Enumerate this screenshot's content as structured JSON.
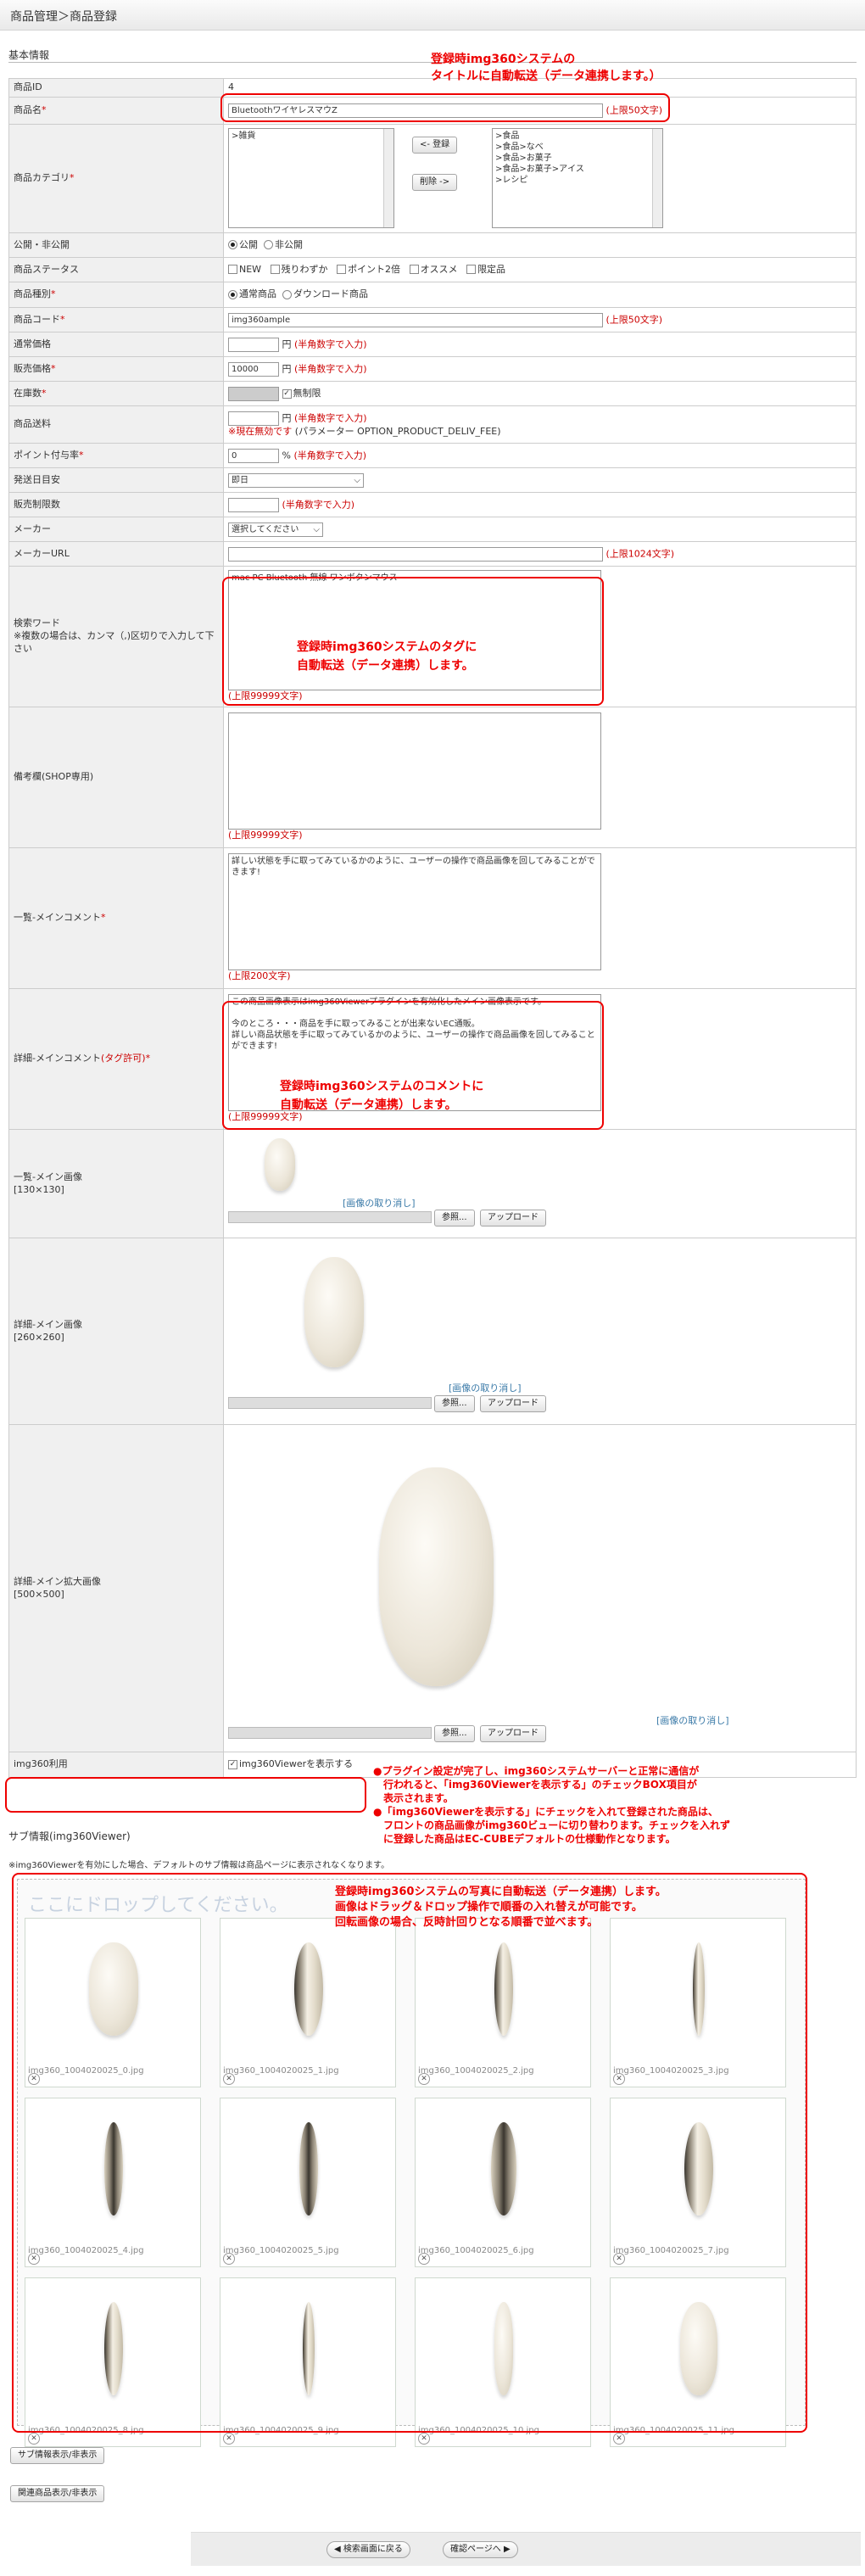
{
  "header": {
    "title": "商品管理＞商品登録"
  },
  "section": {
    "basic": "基本情報",
    "sub_info": "サブ情報(img360Viewer)"
  },
  "fields": {
    "product_id": {
      "label": "商品ID",
      "value": "4"
    },
    "product_name": {
      "label": "商品名",
      "value": "BluetoothワイヤレスマウZ",
      "note": "(上限50文字)"
    },
    "category": {
      "label": "商品カテゴリ",
      "left_list": [
        ">雑貨"
      ],
      "right_list": [
        ">食品",
        ">食品>なべ",
        ">食品>お菓子",
        ">食品>お菓子>アイス",
        ">レシピ"
      ],
      "add_button": "<- 登録",
      "remove_button": "削除 ->"
    },
    "publish": {
      "label": "公開・非公開",
      "options": [
        "公開",
        "非公開"
      ]
    },
    "status": {
      "label": "商品ステータス",
      "options": [
        "NEW",
        "残りわずか",
        "ポイント2倍",
        "オススメ",
        "限定品"
      ]
    },
    "kind": {
      "label": "商品種別",
      "options": [
        "通常商品",
        "ダウンロード商品"
      ]
    },
    "code": {
      "label": "商品コード",
      "value": "img360ample",
      "note": "(上限50文字)"
    },
    "normal_price": {
      "label": "通常価格",
      "unit": "円",
      "note": "(半角数字で入力)"
    },
    "sale_price": {
      "label": "販売価格",
      "value": "10000",
      "unit": "円",
      "note": "(半角数字で入力)"
    },
    "stock": {
      "label": "在庫数",
      "unlimited": "無制限"
    },
    "shipping": {
      "label": "商品送料",
      "unit": "円",
      "note": "(半角数字で入力)",
      "note2": "※現在無効です",
      "param": "(パラメーター OPTION_PRODUCT_DELIV_FEE)"
    },
    "point_rate": {
      "label": "ポイント付与率",
      "value": "0",
      "unit": "%",
      "note": "(半角数字で入力)"
    },
    "ship_date": {
      "label": "発送日目安",
      "value": "即日"
    },
    "sale_limit": {
      "label": "販売制限数",
      "note": "(半角数字で入力)"
    },
    "maker": {
      "label": "メーカー",
      "value": "選択してください"
    },
    "maker_url": {
      "label": "メーカーURL",
      "note": "(上限1024文字)"
    },
    "search_word": {
      "label": "検索ワード",
      "sublabel": "※複数の場合は、カンマ（,)区切りで入力して下さい",
      "value": "mac PC Bluetooth 無線 ワンボタンマウス",
      "note": "(上限99999文字)"
    },
    "memo": {
      "label": "備考欄(SHOP専用)",
      "note": "(上限99999文字)"
    },
    "list_comment": {
      "label": "一覧-メインコメント",
      "value": "詳しい状態を手に取ってみているかのように、ユーザーの操作で商品画像を回してみることができます!",
      "note": "(上限200文字)"
    },
    "detail_comment": {
      "label": "詳細-メインコメント",
      "tag": "(タグ許可)",
      "value": "この商品画像表示はimg360Viewerプラグインを有効化したメイン画像表示です。\n\n今のところ・・・商品を手に取ってみることが出来ないEC通販。\n詳しい商品状態を手に取ってみているかのように、ユーザーの操作で商品画像を回してみることができます!",
      "note": "(上限99999文字)"
    },
    "list_image": {
      "label": "一覧-メイン画像",
      "size": "[130×130]",
      "delete": "[画像の取り消し]",
      "browse": "参照...",
      "upload": "アップロード"
    },
    "detail_image": {
      "label": "詳細-メイン画像",
      "size": "[260×260]",
      "delete": "[画像の取り消し]",
      "browse": "参照...",
      "upload": "アップロード"
    },
    "large_image": {
      "label": "詳細-メイン拡大画像",
      "size": "[500×500]",
      "delete": "[画像の取り消し]",
      "browse": "参照...",
      "upload": "アップロード"
    },
    "img360": {
      "label": "img360利用",
      "checkbox": "img360Viewerを表示する"
    }
  },
  "sub_note": "※img360Viewerを有効にした場合、デフォルトのサブ情報は商品ページに表示されなくなります。",
  "drop": {
    "placeholder": "ここにドロップしてください。"
  },
  "thumbs": [
    "img360_1004020025_0.jpg",
    "img360_1004020025_1.jpg",
    "img360_1004020025_2.jpg",
    "img360_1004020025_3.jpg",
    "img360_1004020025_4.jpg",
    "img360_1004020025_5.jpg",
    "img360_1004020025_6.jpg",
    "img360_1004020025_7.jpg",
    "img360_1004020025_8.jpg",
    "img360_1004020025_9.jpg",
    "img360_1004020025_10.jpg",
    "img360_1004020025_11.jpg"
  ],
  "buttons": {
    "sub_toggle": "サブ情報表示/非表示",
    "related_toggle": "関連商品表示/非表示",
    "back": "検索画面に戻る",
    "confirm": "確認ページへ"
  },
  "callouts": {
    "title": "登録時img360システムの\nタイトルに自動転送（データ連携します。）",
    "tag": "登録時img360システムのタグに\n自動転送（データ連携）します。",
    "comment": "登録時img360システムのコメントに\n自動転送（データ連携）します。",
    "plugin": "●プラグイン設定が完了し、img360システムサーバーと正常に通信が\n　行われると、「img360Viewerを表示する」のチェックBOX項目が\n　表示されます。\n●「img360Viewerを表示する」にチェックを入れて登録された商品は、\n　フロントの商品画像がimg360ビューに切り替わります。チェックを入れず\n　に登録した商品はEC-CUBEデフォルトの仕様動作となります。",
    "photos": "登録時img360システムの写真に自動転送（データ連携）します。\n画像はドラッグ＆ドロップ操作で順番の入れ替えが可能です。\n回転画像の場合、反時計回りとなる順番で並べます。"
  },
  "colors": {
    "accent_red": "#e00000",
    "note_red": "#cc0000",
    "label_bg": "#f0f0f0",
    "link": "#3a7aa8"
  }
}
